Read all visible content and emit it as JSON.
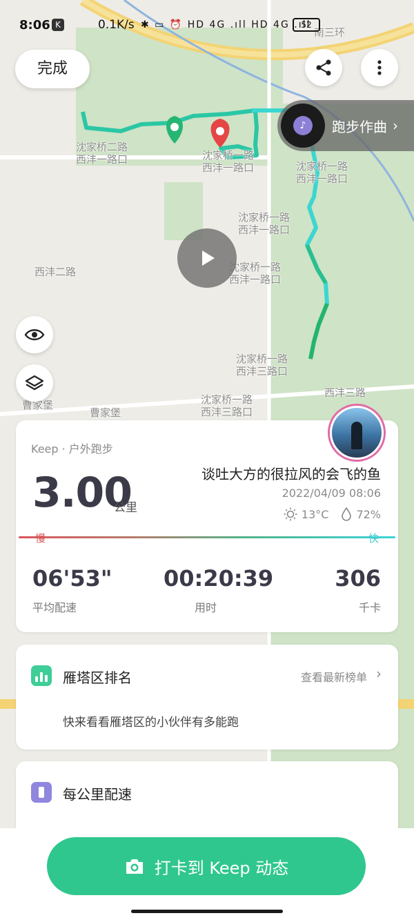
{
  "status": {
    "time": "8:06",
    "k_badge": "K",
    "speed": "0.1K/s",
    "icons": "✱ ▭ ⏰ HD 4G .ıll HD 4G .ıll",
    "battery": "52"
  },
  "top": {
    "done_label": "完成",
    "compose_label": "跑步作曲",
    "compose_chevron": "›"
  },
  "map_labels": [
    "沈家桥二路\n西沣一路口",
    "沈家桥一路\n西沣一路口",
    "沈家桥一路\n西沣一路口",
    "沈家桥一路\n西沣一路口",
    "西沣二路",
    "沈家桥一路\n西沣一路口",
    "沈家桥一路\n西沣三路口",
    "曹家堡",
    "曹家堡",
    "沈家桥一路\n西沣三路口",
    "西沣三路",
    "南三环"
  ],
  "summary": {
    "source": "Keep · 户外跑步",
    "distance": "3.00",
    "unit": "公里",
    "username": "谈吐大方的很拉风的会飞的鱼",
    "datetime": "2022/04/09 08:06",
    "temperature": "13°C",
    "humidity": "72%",
    "slow_label": "慢",
    "fast_label": "快",
    "stats": [
      {
        "value": "06'53\"",
        "label": "平均配速"
      },
      {
        "value": "00:20:39",
        "label": "用时"
      },
      {
        "value": "306",
        "label": "千卡"
      }
    ]
  },
  "rank": {
    "title": "雁塔区排名",
    "more": "查看最新榜单",
    "chevron": "›",
    "desc": "快来看看雁塔区的小伙伴有多能跑"
  },
  "pace": {
    "title": "每公里配速"
  },
  "checkin": {
    "label": "打卡到 Keep 动态"
  }
}
